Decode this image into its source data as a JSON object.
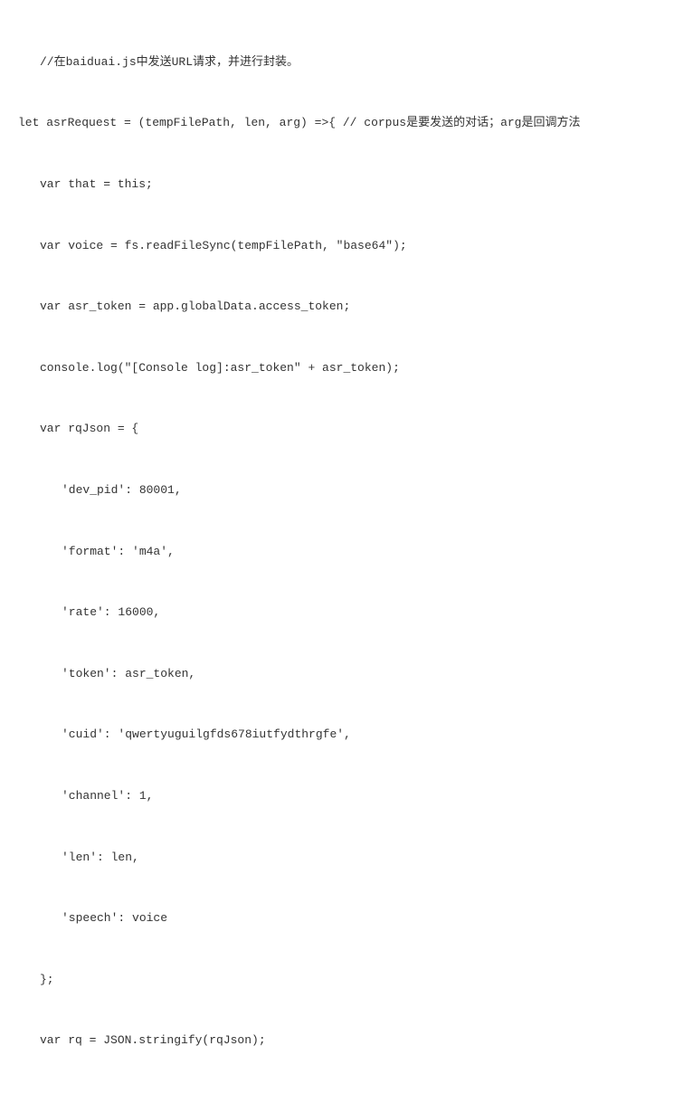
{
  "code": {
    "line1": "//在baiduai.js中发送URL请求，并进行封装。",
    "line2": "let asrRequest = (tempFilePath, len, arg) =>{ // corpus是要发送的对话；arg是回调方法",
    "line3": "var that = this;",
    "line4": "var voice = fs.readFileSync(tempFilePath, \"base64\");",
    "line5": "var asr_token = app.globalData.access_token;",
    "line6": "console.log(\"[Console log]:asr_token\" + asr_token);",
    "line7": "var rqJson = {",
    "line8": "'dev_pid': 80001,",
    "line9": "'format': 'm4a',",
    "line10": "'rate': 16000,",
    "line11": "'token': asr_token,",
    "line12": "'cuid': 'qwertyuguilgfds678iutfydthrgfe',",
    "line13": "'channel': 1,",
    "line14": "'len': len,",
    "line15": "'speech': voice",
    "line16": "};",
    "line17": "var rq = JSON.stringify(rqJson);"
  }
}
